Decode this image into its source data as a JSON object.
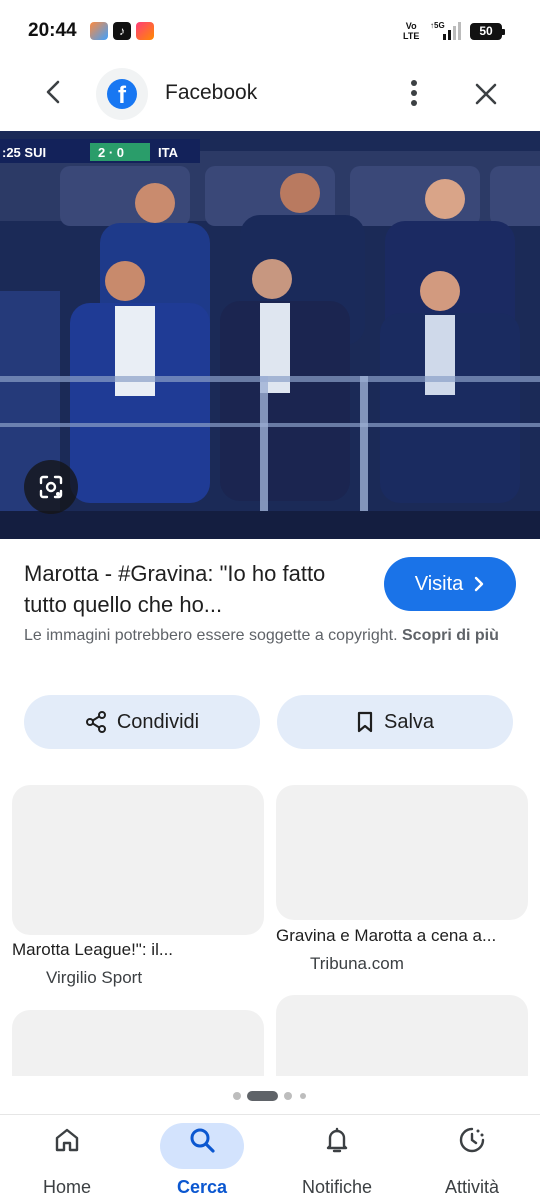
{
  "status_bar": {
    "time": "20:44",
    "volte": "Vo\nLTE",
    "network": "5G",
    "battery": "50"
  },
  "header": {
    "title": "Facebook",
    "logo_letter": "f"
  },
  "hero": {
    "scoreboard": "SUI 2 0 ITA",
    "score_left": "25"
  },
  "result": {
    "title": "Marotta - #Gravina: \"Io ho fatto tutto quello che ho...",
    "visit_label": "Visita",
    "copyright_text": "Le immagini potrebbero essere soggette a copyright.",
    "copyright_link": "Scopri di più"
  },
  "actions": {
    "share_label": "Condividi",
    "save_label": "Salva"
  },
  "related": [
    {
      "title": "Marotta League!\": il...",
      "source": "Virgilio Sport"
    },
    {
      "title": "Gravina e Marotta a cena a...",
      "source": "Tribuna.com"
    }
  ],
  "bottom_nav": {
    "items": [
      {
        "label": "Home",
        "icon": "home-icon"
      },
      {
        "label": "Cerca",
        "icon": "search-icon"
      },
      {
        "label": "Notifiche",
        "icon": "bell-icon"
      },
      {
        "label": "Attività",
        "icon": "activity-icon"
      }
    ],
    "active_index": 1
  },
  "colors": {
    "accent": "#1a73e8",
    "pill_bg": "#e3ecf9",
    "nav_active": "#d3e3fd"
  }
}
